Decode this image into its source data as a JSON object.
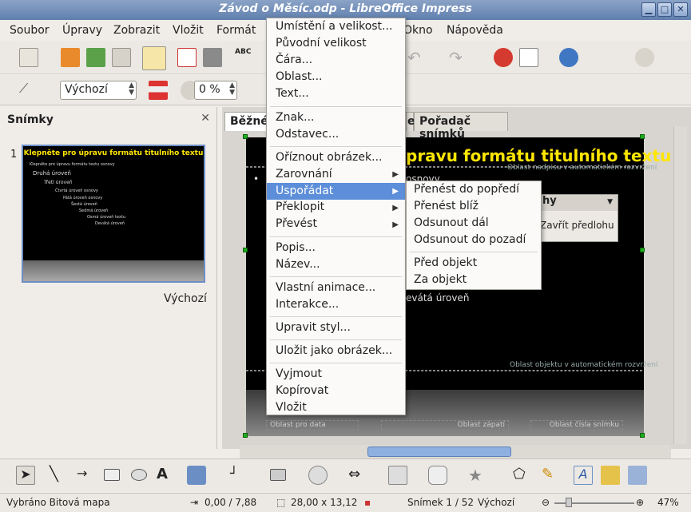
{
  "window": {
    "title": "Závod o Měsíc.odp - LibreOffice Impress"
  },
  "menubar": [
    "Soubor",
    "Úpravy",
    "Zobrazit",
    "Vložit",
    "Formát",
    "Okno",
    "Nápověda"
  ],
  "toolbar2": {
    "style_value": "Výchozí",
    "transparency_value": "0 %"
  },
  "slides_pane": {
    "title": "Snímky",
    "slide_number": "1",
    "slide_name": "Výchozí",
    "thumb_title": "Klepněte pro úpravu formátu titulního textu",
    "thumb_levels": [
      "Klepněte pro úpravu formátu textu osnovy",
      "Druhá úroveň",
      "Třetí úroveň",
      "Čtvrtá úroveň osnovy",
      "Pátá úroveň osnovy",
      "Šestá úroveň",
      "Sedmá úroveň",
      "Osmá úroveň textu",
      "Devátá úroveň"
    ]
  },
  "tabs": {
    "normal": "Běžné",
    "sorter": "Pořadač snímků",
    "partial": "e"
  },
  "slide": {
    "title_partial": "pravu formátu titulního textu",
    "title_area_label": "Oblast nadpisu v automatickém rozvržení",
    "bullet_partial": "osnovy",
    "level_partial": "evátá úroveň",
    "outline_area_label": "Oblast objektu v automatickém rozvržení",
    "date_area": "Oblast pro data",
    "footer_area": "Oblast zápatí",
    "number_area": "Oblast čísla snímku",
    "panel_title_partial": "hy",
    "panel_button_partial": "Zavřít předlohu"
  },
  "context_menu": [
    {
      "label": "Umístění a velikost...",
      "submenu": false,
      "highlighted": false
    },
    {
      "label": "Původní velikost",
      "submenu": false,
      "highlighted": false
    },
    {
      "label": "Čára...",
      "submenu": false,
      "highlighted": false
    },
    {
      "label": "Oblast...",
      "submenu": false,
      "highlighted": false
    },
    {
      "label": "Text...",
      "submenu": false,
      "highlighted": false
    },
    {
      "label": "Znak...",
      "submenu": false,
      "highlighted": false
    },
    {
      "label": "Odstavec...",
      "submenu": false,
      "highlighted": false
    },
    {
      "label": "Oříznout obrázek...",
      "submenu": false,
      "highlighted": false
    },
    {
      "label": "Zarovnání",
      "submenu": true,
      "highlighted": false
    },
    {
      "label": "Uspořádat",
      "submenu": true,
      "highlighted": true
    },
    {
      "label": "Překlopit",
      "submenu": true,
      "highlighted": false
    },
    {
      "label": "Převést",
      "submenu": true,
      "highlighted": false
    },
    {
      "label": "Popis...",
      "submenu": false,
      "highlighted": false
    },
    {
      "label": "Název...",
      "submenu": false,
      "highlighted": false
    },
    {
      "label": "Vlastní animace...",
      "submenu": false,
      "highlighted": false
    },
    {
      "label": "Interakce...",
      "submenu": false,
      "highlighted": false
    },
    {
      "label": "Upravit styl...",
      "submenu": false,
      "highlighted": false
    },
    {
      "label": "Uložit jako obrázek...",
      "submenu": false,
      "highlighted": false
    },
    {
      "label": "Vyjmout",
      "submenu": false,
      "highlighted": false
    },
    {
      "label": "Kopírovat",
      "submenu": false,
      "highlighted": false
    },
    {
      "label": "Vložit",
      "submenu": false,
      "highlighted": false
    }
  ],
  "arrange_submenu": [
    "Přenést do popředí",
    "Přenést blíž",
    "Odsunout dál",
    "Odsunout do pozadí",
    "Před objekt",
    "Za objekt"
  ],
  "statusbar": {
    "selection": "Vybráno Bitová mapa",
    "position": "0,00 / 7,88",
    "size": "28,00 x 13,12",
    "slide": "Snímek 1 / 52",
    "layout": "Výchozí",
    "zoom": "47%"
  },
  "colors": {
    "highlight": "#5d8ed9",
    "slide_title": "#ffe600",
    "titlebar": "#6f8db8"
  }
}
